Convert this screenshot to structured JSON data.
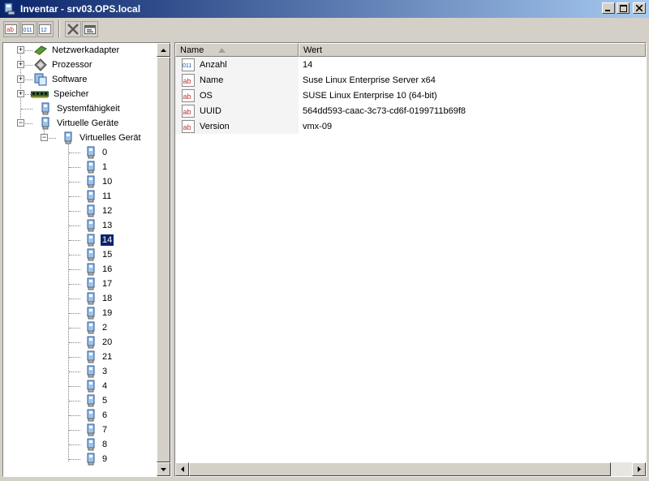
{
  "window": {
    "title": "Inventar - srv03.OPS.local"
  },
  "toolbar": {
    "buttons": [
      "string-icon",
      "binary-icon",
      "number-icon",
      "delete-icon",
      "properties-icon"
    ]
  },
  "tree": {
    "nodes": [
      {
        "label": "Netzwerkadapter",
        "icon": "network-adapter-icon",
        "expander": "+"
      },
      {
        "label": "Prozessor",
        "icon": "processor-icon",
        "expander": "+"
      },
      {
        "label": "Software",
        "icon": "software-icon",
        "expander": "+"
      },
      {
        "label": "Speicher",
        "icon": "memory-icon",
        "expander": "+"
      },
      {
        "label": "Systemfähigkeit",
        "icon": "device-icon",
        "expander": ""
      },
      {
        "label": "Virtuelle Geräte",
        "icon": "device-icon",
        "expander": "−"
      },
      {
        "label": "Virtuelles Gerät",
        "icon": "device-icon",
        "expander": "−"
      }
    ],
    "devices": [
      "0",
      "1",
      "10",
      "11",
      "12",
      "13",
      "14",
      "15",
      "16",
      "17",
      "18",
      "19",
      "2",
      "20",
      "21",
      "3",
      "4",
      "5",
      "6",
      "7",
      "8",
      "9"
    ],
    "selected": "14"
  },
  "list": {
    "columns": {
      "name": "Name",
      "value": "Wert"
    },
    "rows": [
      {
        "name": "Anzahl",
        "value": "14",
        "icon": "binary-icon"
      },
      {
        "name": "Name",
        "value": "Suse Linux Enterprise Server x64",
        "icon": "string-icon"
      },
      {
        "name": "OS",
        "value": "SUSE Linux Enterprise 10 (64-bit)",
        "icon": "string-icon"
      },
      {
        "name": "UUID",
        "value": "564dd593-caac-3c73-cd6f-0199711b69f8",
        "icon": "string-icon"
      },
      {
        "name": "Version",
        "value": "vmx-09",
        "icon": "string-icon"
      }
    ]
  }
}
